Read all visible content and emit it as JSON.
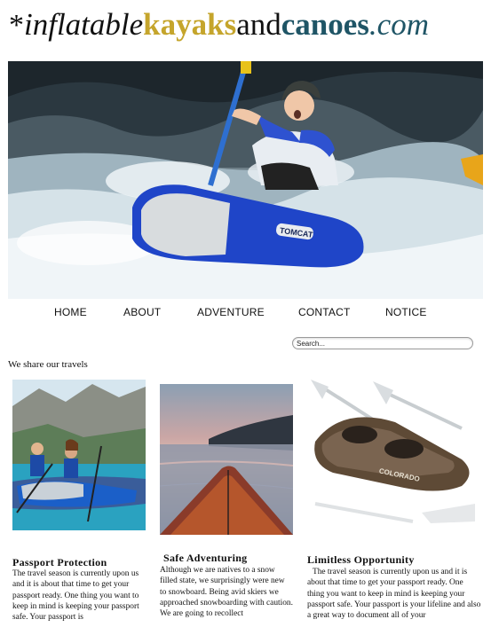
{
  "logo": {
    "star": "*",
    "w1": "inflatable",
    "w2": "kayaks",
    "w3": "and",
    "w4": "canoes",
    "w5": ".com"
  },
  "nav": {
    "items": [
      {
        "label": "HOME"
      },
      {
        "label": "ABOUT"
      },
      {
        "label": "ADVENTURE"
      },
      {
        "label": "CONTACT"
      },
      {
        "label": "NOTICE"
      }
    ]
  },
  "search": {
    "placeholder": "Search..."
  },
  "intro": {
    "text": "We share our travels"
  },
  "cards": [
    {
      "title": "Passport Protection",
      "text": "The travel season is currently upon us and it is about that time to get your passport ready. One thing you want to keep in mind is keeping your passport safe. Your passport is"
    },
    {
      "title": "Safe Adventuring",
      "text": "Although we are natives to a snow filled state, we surprisingly were new to snowboard. Being avid skiers we approached snowboarding with caution. We are going to recollect"
    },
    {
      "title": "Limitless Opportunity",
      "text": "The travel season is currently upon us and it is about that time to get your passport ready. One thing you want to keep in mind is keeping your passport safe. Your passport is your lifeline and also a great way to document all of your"
    }
  ],
  "hero": {
    "kayak_brand": "TOMCAT"
  },
  "card_images": {
    "kayak_brand": "COLORADO"
  },
  "colors": {
    "logo_gold": "#c5a52c",
    "logo_teal": "#1f5566",
    "kayak_blue": "#1f45c8"
  }
}
